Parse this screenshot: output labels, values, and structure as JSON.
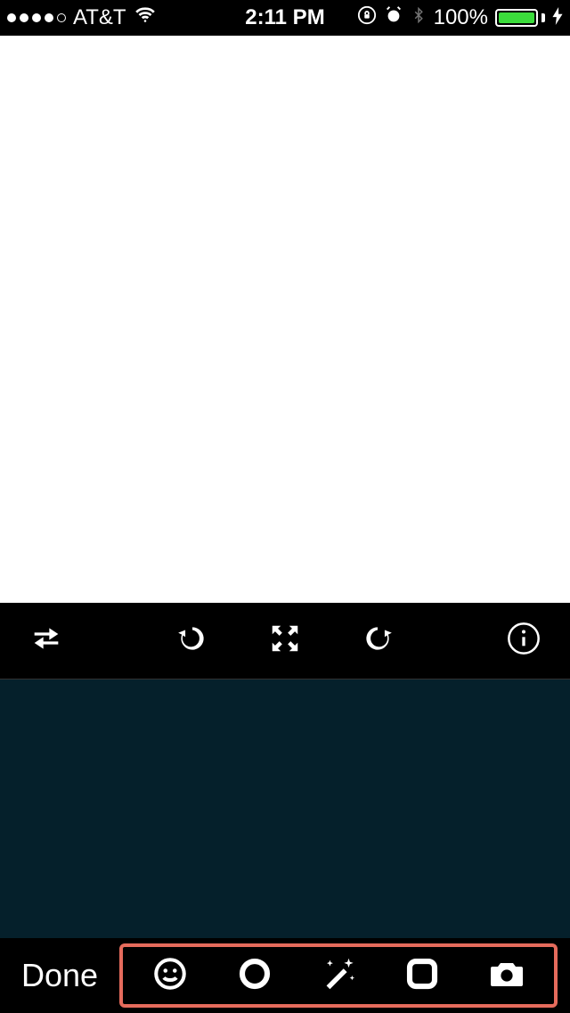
{
  "status": {
    "carrier": "AT&T",
    "time": "2:11 PM",
    "battery_pct": "100%"
  },
  "bottom": {
    "done_label": "Done"
  },
  "colors": {
    "highlight_border": "#e56b5c",
    "dark_panel": "#05202b",
    "battery_fill": "#3bdc3b"
  }
}
